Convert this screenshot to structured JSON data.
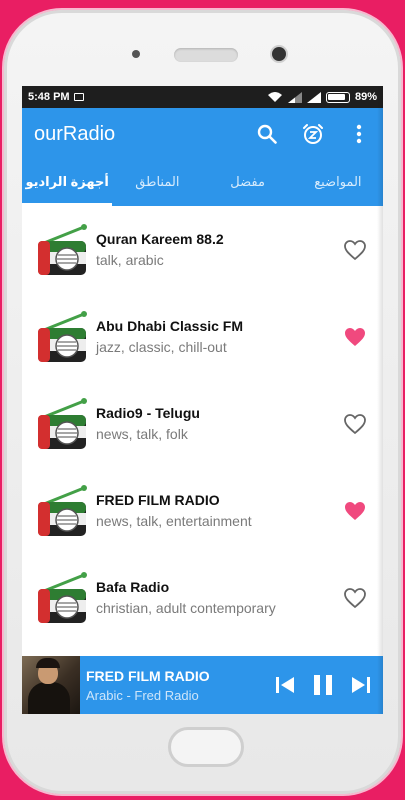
{
  "status": {
    "time": "5:48 PM",
    "battery": "89%"
  },
  "app": {
    "title": "ourRadio"
  },
  "tabs": [
    {
      "label": "أجهزة الراديو",
      "active": true
    },
    {
      "label": "المناطق"
    },
    {
      "label": "مفضل"
    },
    {
      "label": "المواضيع"
    }
  ],
  "stations": [
    {
      "title": "Quran Kareem 88.2",
      "tags": "talk, arabic",
      "favorite": false
    },
    {
      "title": "Abu Dhabi Classic FM",
      "tags": "jazz, classic, chill-out",
      "favorite": true
    },
    {
      "title": "Radio9 - Telugu",
      "tags": "news, talk, folk",
      "favorite": false
    },
    {
      "title": "FRED FILM RADIO",
      "tags": "news, talk, entertainment",
      "favorite": true
    },
    {
      "title": "Bafa Radio",
      "tags": "christian, adult contemporary",
      "favorite": false
    }
  ],
  "player": {
    "title": "FRED FILM RADIO",
    "subtitle": "Arabic - Fred Radio"
  },
  "colors": {
    "accent": "#2d95ea",
    "favorite": "#f0497e",
    "background": "#e91e63"
  },
  "icons": [
    "search-icon",
    "alarm-snooze-icon",
    "more-vert-icon",
    "heart-icon",
    "skip-previous-icon",
    "pause-icon",
    "skip-next-icon",
    "radio-flag-icon"
  ]
}
